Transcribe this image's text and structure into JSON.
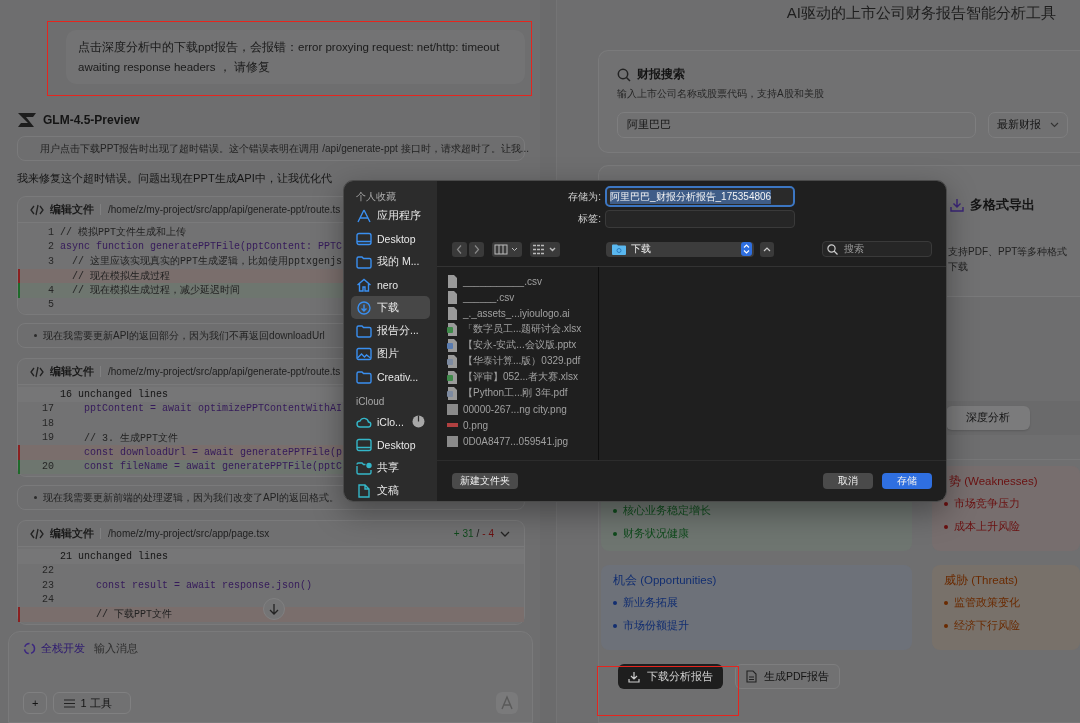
{
  "chat": {
    "user_message": "点击深度分析中的下载ppt报告，会报错：error proxying request: net/http: timeout awaiting response headers ， 请修复",
    "model_name": "GLM-4.5-Preview",
    "blocks": [
      {
        "kind": "thought",
        "text": "用户点击下载PPT报告时出现了超时错误。这个错误表明在调用 /api/generate-ppt 接口时，请求超时了。让我..."
      },
      {
        "kind": "reply",
        "text": "我来修复这个超时错误。问题出现在PPT生成API中，让我优化代"
      },
      {
        "kind": "edit",
        "title": "编辑文件",
        "path": "/home/z/my-project/src/app/api/generate-ppt/route.ts",
        "lines": [
          {
            "no": "1",
            "text": "// 模拟PPT文件生成和上传",
            "kind": "comment",
            "removed": false,
            "added": false
          },
          {
            "no": "2",
            "text": "async function generatePPTFile(pptContent: PPTC",
            "kind": "code",
            "removed": false,
            "added": false
          },
          {
            "no": "3",
            "text": "  // 这里应该实现真实的PPT生成逻辑，比如使用pptxgenjs",
            "kind": "comment",
            "removed": false,
            "added": false
          },
          {
            "text": "  // 现在模拟生成过程",
            "kind": "comment",
            "removed": true,
            "added": false
          },
          {
            "no": "4",
            "text": "  // 现在模拟生成过程，减少延迟时间",
            "kind": "comment",
            "removed": false,
            "added": true
          },
          {
            "no": "5",
            "kind": "code",
            "removed": false,
            "added": false
          }
        ]
      },
      {
        "kind": "thought",
        "text": "现在我需要更新API的返回部分，因为我们不再返回downloadUrl"
      },
      {
        "kind": "edit",
        "title": "编辑文件",
        "path": "/home/z/my-project/src/app/api/generate-ppt/route.ts",
        "lines": [
          {
            "text": "16 unchanged lines",
            "kind": "fold",
            "removed": false,
            "added": false
          },
          {
            "no": "17",
            "text": "    pptContent = await optimizePPTContentWithAI",
            "kind": "code",
            "removed": false,
            "added": false
          },
          {
            "no": "18",
            "kind": "code",
            "removed": false,
            "added": false
          },
          {
            "no": "19",
            "text": "    // 3. 生成PPT文件",
            "kind": "comment",
            "removed": false,
            "added": false
          },
          {
            "text": "    const downloadUrl = await generatePPTFile(p",
            "kind": "code",
            "removed": true,
            "added": false
          },
          {
            "no": "20",
            "text": "    const fileName = await generatePPTFile(pptC",
            "kind": "code",
            "removed": false,
            "added": true
          }
        ]
      },
      {
        "kind": "thought",
        "text": "现在我需要更新前端的处理逻辑，因为我们改变了API的返回格式。"
      },
      {
        "kind": "edit",
        "title": "编辑文件",
        "path": "/home/z/my-project/src/app/page.tsx",
        "added": "+ 31",
        "separator": "/",
        "removed": "- 4",
        "lines": [
          {
            "text": "21 unchanged lines",
            "kind": "fold",
            "removed": false,
            "added": false
          },
          {
            "no": "22",
            "kind": "code",
            "removed": false,
            "added": false
          },
          {
            "no": "23",
            "text": "      const result = await response.json()",
            "kind": "code",
            "removed": false,
            "added": false
          },
          {
            "no": "24",
            "kind": "code",
            "removed": false,
            "added": false
          },
          {
            "text": "      // 下载PPT文件",
            "kind": "comment",
            "removed": true,
            "added": false
          }
        ]
      }
    ],
    "composer": {
      "mode": "全栈开发",
      "placeholder": "输入消息",
      "add": "+",
      "tools": "1 工具"
    }
  },
  "app": {
    "subtitle": "AI驱动的上市公司财务报告智能分析工具",
    "search": {
      "title": "财报搜索",
      "hint": "输入上市公司名称或股票代码，支持A股和美股",
      "value": "阿里巴巴",
      "period": "最新财报"
    },
    "feature": {
      "title": "多格式导出",
      "text": "支持PDF、PPT等多种格式下载"
    },
    "tabs": [
      {
        "label": "深度分析",
        "selected": true
      }
    ],
    "swot": [
      {
        "kind": "strengths",
        "items": [
          "核心业务稳定增长",
          "财务状况健康"
        ]
      },
      {
        "kind": "weaknesses",
        "title": "势 (Weaknesses)",
        "items": [
          "市场竞争压力",
          "成本上升风险"
        ]
      },
      {
        "kind": "opportunities",
        "title": "机会 (Opportunities)",
        "items": [
          "新业务拓展",
          "市场份额提升"
        ]
      },
      {
        "kind": "threats",
        "title": "威胁 (Threats)",
        "items": [
          "监管政策变化",
          "经济下行风险"
        ]
      }
    ],
    "actions": [
      {
        "label": "下载分析报告",
        "kind": "primary"
      },
      {
        "label": "生成PDF报告",
        "kind": "secondary"
      }
    ]
  },
  "save_dialog": {
    "save_as_label": "存储为:",
    "file_name": "阿里巴巴_财报分析报告_175354806",
    "tags_label": "标签:",
    "location": "下载",
    "search_placeholder": "搜索",
    "sections": [
      {
        "title": "个人收藏",
        "items": [
          {
            "label": "应用程序",
            "kind": "apps",
            "selected": false
          },
          {
            "label": "Desktop",
            "kind": "desktop",
            "selected": false
          },
          {
            "label": "我的 M...",
            "kind": "folder",
            "selected": false
          },
          {
            "label": "nero",
            "kind": "home",
            "selected": false
          },
          {
            "label": "下载",
            "kind": "download",
            "selected": true
          },
          {
            "label": "报告分...",
            "kind": "folder",
            "selected": false
          },
          {
            "label": "图片",
            "kind": "photos",
            "selected": false
          },
          {
            "label": "Creativ...",
            "kind": "folder",
            "selected": false
          }
        ]
      },
      {
        "title": "iCloud",
        "items": [
          {
            "label": "iClo...",
            "kind": "cloud",
            "selected": false
          },
          {
            "label": "Desktop",
            "kind": "desktop",
            "selected": false
          },
          {
            "label": "共享",
            "kind": "shared",
            "selected": false
          },
          {
            "label": "文稿",
            "kind": "document",
            "selected": false
          }
        ]
      }
    ],
    "files": [
      {
        "name": "___________.csv",
        "kind": "doc"
      },
      {
        "name": "______.csv",
        "kind": "doc"
      },
      {
        "name": "_._assets_...iyioulogo.ai",
        "kind": "doc"
      },
      {
        "name": "「数字员工...题研讨会.xlsx",
        "kind": "sheet"
      },
      {
        "name": "【安永-安武...会议版.pptx",
        "kind": "slides"
      },
      {
        "name": "【华泰计算...版）0329.pdf",
        "kind": "pdf"
      },
      {
        "name": "【评审】052...者大赛.xlsx",
        "kind": "sheet"
      },
      {
        "name": "【Python工...刚 3年.pdf",
        "kind": "pdf"
      },
      {
        "name": "00000-267...ng city.png",
        "kind": "image"
      },
      {
        "name": "0.png",
        "kind": "strip"
      },
      {
        "name": "0D0A8477...059541.jpg",
        "kind": "image"
      }
    ],
    "new_folder": "新建文件夹",
    "cancel": "取消",
    "save": "存储"
  }
}
